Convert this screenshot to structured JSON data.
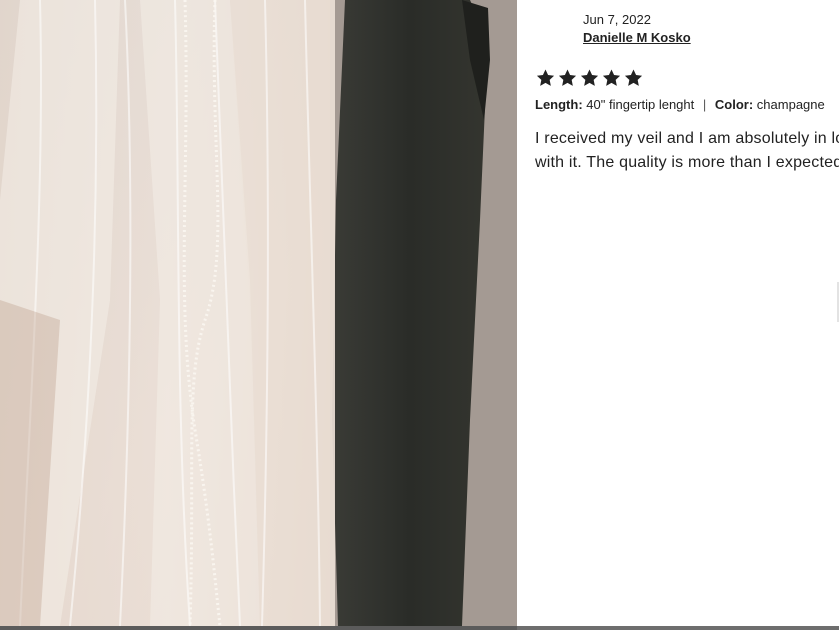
{
  "photo": {
    "icon": "bridal-veil-photo",
    "description_colors": {
      "wall": "#c9b9ad",
      "veil": "#efe6df",
      "dark_garment": "#2f312d"
    }
  },
  "review": {
    "date": "Jun 7, 2022",
    "author": "Danielle M Kosko",
    "rating": 5,
    "rating_max": 5,
    "star_icon": "star-icon",
    "variations": [
      {
        "key": "Length:",
        "value": "40\" fingertip lenght"
      },
      {
        "key": "Color:",
        "value": "champagne"
      }
    ],
    "text": "I received my veil and I am absolutely in love with it. The quality is more than I expected!"
  },
  "colors": {
    "text": "#222222",
    "star": "#222222",
    "bottom_bar": "#5b5b5b"
  }
}
